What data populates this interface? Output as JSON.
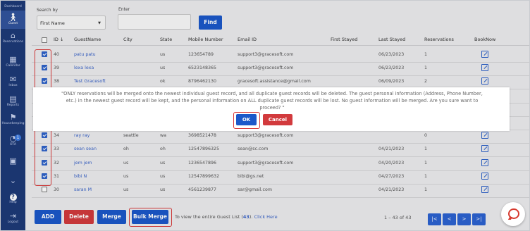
{
  "sidebar": {
    "items": [
      {
        "label": "Dashboard",
        "icon": "dashboard-icon",
        "glyph": "▦"
      },
      {
        "label": "Guest",
        "icon": "guest-icon",
        "glyph": "🚶"
      },
      {
        "label": "Reservations",
        "icon": "reservations-icon",
        "glyph": "⌂"
      },
      {
        "label": "Calendar",
        "icon": "calendar-icon",
        "glyph": "▦"
      },
      {
        "label": "Inbox",
        "icon": "inbox-icon",
        "glyph": "✉"
      },
      {
        "label": "Reports",
        "icon": "reports-icon",
        "glyph": "▤"
      },
      {
        "label": "Housekeeping",
        "icon": "housekeeping-icon",
        "glyph": "⚑"
      },
      {
        "label": "OTA",
        "icon": "ota-icon",
        "glyph": "◔",
        "badge": "1"
      },
      {
        "label": "Settings",
        "icon": "settings-icon",
        "glyph": "▣"
      },
      {
        "label": "",
        "icon": "chevron-down-icon",
        "glyph": "⌄"
      },
      {
        "label": "Help",
        "icon": "help-icon",
        "glyph": "?"
      },
      {
        "label": "Logout",
        "icon": "logout-icon",
        "glyph": "⇥"
      }
    ]
  },
  "search": {
    "search_by_label": "Search by",
    "search_by_value": "First Name",
    "enter_label": "Enter",
    "enter_value": "",
    "find_label": "Find"
  },
  "table": {
    "headers": [
      "ID ↓",
      "GuestName",
      "City",
      "State",
      "Mobile Number",
      "Email ID",
      "First Stayed",
      "Last Stayed",
      "Reservations",
      "BookNow"
    ],
    "rows": [
      {
        "checked": true,
        "id": "40",
        "name": "patu patu",
        "city": "",
        "state": "us",
        "mobile": "123654789",
        "email": "support3@gracesoft.com",
        "first": "",
        "last": "06/23/2023",
        "res": "1"
      },
      {
        "checked": true,
        "id": "39",
        "name": "lexa lexa",
        "city": "",
        "state": "us",
        "mobile": "6523148365",
        "email": "support3@gracesoft.com",
        "first": "",
        "last": "06/23/2023",
        "res": "1"
      },
      {
        "checked": true,
        "id": "38",
        "name": "Test Gracesoft",
        "city": "",
        "state": "ok",
        "mobile": "8796462130",
        "email": "gracesoft.assistance@gmail.com",
        "first": "",
        "last": "06/09/2023",
        "res": "2"
      },
      {
        "checked": true,
        "id": "",
        "name": "",
        "city": "",
        "state": "",
        "mobile": "",
        "email": "",
        "first": "",
        "last": "",
        "res": ""
      },
      {
        "checked": true,
        "id": "",
        "name": "",
        "city": "",
        "state": "",
        "mobile": "",
        "email": "",
        "first": "",
        "last": "",
        "res": ""
      },
      {
        "checked": true,
        "id": "",
        "name": "",
        "city": "",
        "state": "",
        "mobile": "",
        "email": "",
        "first": "",
        "last": "",
        "res": ""
      },
      {
        "checked": true,
        "id": "34",
        "name": "ray ray",
        "city": "seattle",
        "state": "wa",
        "mobile": "3698521478",
        "email": "support3@gracesoft.com",
        "first": "",
        "last": "",
        "res": "0"
      },
      {
        "checked": true,
        "id": "33",
        "name": "sean sean",
        "city": "oh",
        "state": "oh",
        "mobile": "12547896325",
        "email": "sean@sc.com",
        "first": "",
        "last": "04/21/2023",
        "res": "1"
      },
      {
        "checked": true,
        "id": "32",
        "name": "jem jem",
        "city": "us",
        "state": "us",
        "mobile": "1236547896",
        "email": "support3@gracesoft.com",
        "first": "",
        "last": "04/20/2023",
        "res": "1"
      },
      {
        "checked": true,
        "id": "31",
        "name": "bibi N",
        "city": "us",
        "state": "us",
        "mobile": "12547899632",
        "email": "bibi@gs.net",
        "first": "",
        "last": "04/27/2023",
        "res": "1"
      },
      {
        "checked": false,
        "id": "30",
        "name": "saran M",
        "city": "us",
        "state": "us",
        "mobile": "4561239877",
        "email": "sar@gmail.com",
        "first": "",
        "last": "04/21/2023",
        "res": "1"
      }
    ]
  },
  "footer": {
    "add_label": "ADD",
    "delete_label": "Delete",
    "merge_label": "Merge",
    "bulk_merge_label": "Bulk Merge",
    "info_prefix": "To view the entire Guest List (",
    "info_count": "43",
    "info_mid": "). ",
    "info_link": "Click Here",
    "range": "1 – 43 of 43",
    "pager": [
      "|<",
      "<",
      ">",
      ">|"
    ]
  },
  "dialog": {
    "message": "\"ONLY reservations will be merged onto the newest individual guest record, and all duplicate guest records will be deleted. The guest personal information (Address, Phone Number, etc.) in the newest guest record will be kept, and the personal information on ALL duplicate guest records will be lost. No guest information will be merged. Are you sure want to proceed? \"",
    "ok_label": "OK",
    "cancel_label": "Cancel"
  },
  "colors": {
    "sidebar": "#1d3a78",
    "primary": "#1b58c9",
    "danger": "#d23a3d",
    "highlight": "#d83a3a"
  }
}
